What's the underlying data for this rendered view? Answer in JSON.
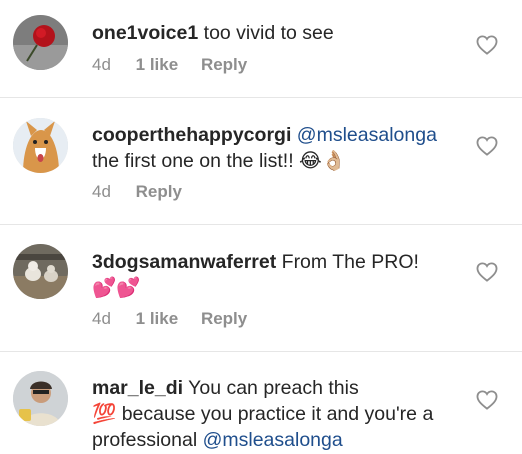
{
  "comments": [
    {
      "username": "one1voice1",
      "text": "too vivid to see",
      "emoji": "",
      "text_after": "",
      "mention": "",
      "time": "4d",
      "likes": "1 like",
      "reply": "Reply"
    },
    {
      "username": "cooperthehappycorgi",
      "mention": "@msleasalonga",
      "text": "the first one on the list!!",
      "emoji": "😂👌🏼",
      "time": "4d",
      "likes": "",
      "reply": "Reply"
    },
    {
      "username": "3dogsamanwaferret",
      "text": "From The PRO!",
      "emoji": "💕💕",
      "time": "4d",
      "likes": "1 like",
      "reply": "Reply"
    },
    {
      "username": "mar_le_di",
      "text": "You can preach this",
      "emoji": "💯",
      "text_after": "because you practice it and you're a professional",
      "mention": "@msleasalonga",
      "time": "",
      "likes": "",
      "reply": ""
    }
  ],
  "icons": {
    "like": "heart-outline-icon"
  },
  "colors": {
    "mention": "#1f4e8c",
    "meta": "#8e8e8e",
    "heart": "#8e8e8e"
  }
}
